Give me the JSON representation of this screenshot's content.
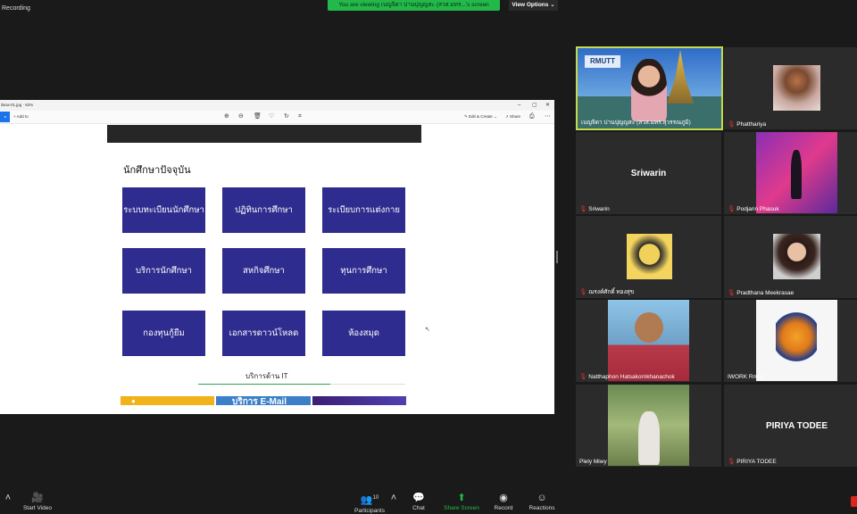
{
  "topbar": {
    "recording_label": "Recording",
    "viewing_banner": "You are viewing เบญจิดา ปานปุญญสะ (สวส.มทร...'s screen",
    "view_options": "View Options"
  },
  "photos_app": {
    "title": "ilana-01.jpg · 62%",
    "add_to": "Add to",
    "edit_create": "Edit & Create",
    "share": "Share"
  },
  "webpage": {
    "heading": "นักศึกษาปัจจุบัน",
    "tiles": [
      "ระบบทะเบียนนักศึกษา",
      "ปฏิทินการศึกษา",
      "ระเบียบการแต่งกาย",
      "บริการนักศึกษา",
      "สหกิจศึกษา",
      "ทุนการศึกษา",
      "กองทุนกู้ยืม",
      "เอกสารดาวน์โหลด",
      "ห้องสมุด"
    ],
    "section_label": "บริการด้าน IT",
    "banner_email": "บริการ E-Mail"
  },
  "participants_tiles": [
    {
      "name": "เบญจิดา ปานปุญญสะ (สวส.มทร.สุวรรณภูมิ)",
      "logo": "RMUTT"
    },
    {
      "name": "Phatthariya"
    },
    {
      "name": "Sriwarin",
      "display": "Sriwarin"
    },
    {
      "name": "Podjarin Phasuk"
    },
    {
      "name": "ณรงค์ศักดิ์ ทองสุข"
    },
    {
      "name": "Pradthana Meekrasae"
    },
    {
      "name": "Natthaphon Hatsakornkhanachok"
    },
    {
      "name": "IWORK Rmutt"
    },
    {
      "name": "Plely Miwy"
    },
    {
      "name": "PIRIYA TODEE",
      "display": "PIRIYA TODEE"
    }
  ],
  "bottombar": {
    "start_video": "Start Video",
    "participants": "Participants",
    "participants_count": "10",
    "chat": "Chat",
    "share_screen": "Share Screen",
    "record": "Record",
    "reactions": "Reactions"
  },
  "colors": {
    "tile_blue": "#2e2c8e",
    "banner_green": "#23b84a",
    "share_green": "#23b84a",
    "muted_red": "#e0322d"
  }
}
